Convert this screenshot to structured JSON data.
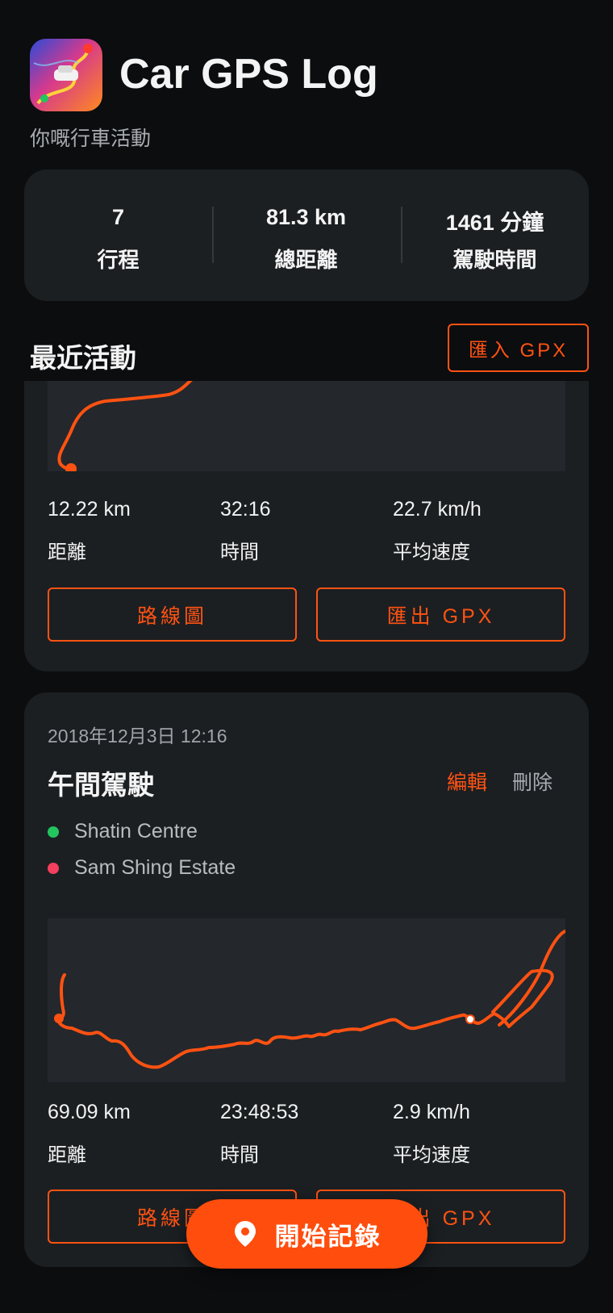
{
  "header": {
    "app_icon": "car-route-map-app-icon",
    "title": "Car GPS Log",
    "subtitle": "你嘅行車活動"
  },
  "summary": [
    {
      "value": "7",
      "label": "行程"
    },
    {
      "value": "81.3 km",
      "label": "總距離"
    },
    {
      "value": "1461 分鐘",
      "label": "駕駛時間"
    }
  ],
  "recent": {
    "title": "最近活動",
    "import_label": "匯入 GPX"
  },
  "trips": [
    {
      "metrics": [
        {
          "value": "12.22 km",
          "label": "距離"
        },
        {
          "value": "32:16",
          "label": "時間"
        },
        {
          "value": "22.7 km/h",
          "label": "平均速度"
        }
      ],
      "route_button": "路線圖",
      "export_button": "匯出 GPX"
    },
    {
      "date": "2018年12月3日 12:16",
      "title": "午間駕駛",
      "edit_label": "編輯",
      "delete_label": "刪除",
      "start": "Shatin Centre",
      "end": "Sam Shing Estate",
      "metrics": [
        {
          "value": "69.09 km",
          "label": "距離"
        },
        {
          "value": "23:48:53",
          "label": "時間"
        },
        {
          "value": "2.9 km/h",
          "label": "平均速度"
        }
      ],
      "route_button": "路線圖",
      "export_button": "匯出 GPX"
    }
  ],
  "fab": {
    "label": "開始記錄",
    "icon": "location-pin-icon"
  },
  "colors": {
    "accent": "#ff5212",
    "start_dot": "#22c55e",
    "end_dot": "#f43f5e",
    "card": "#1b1f22",
    "background": "#0b0d0f"
  }
}
